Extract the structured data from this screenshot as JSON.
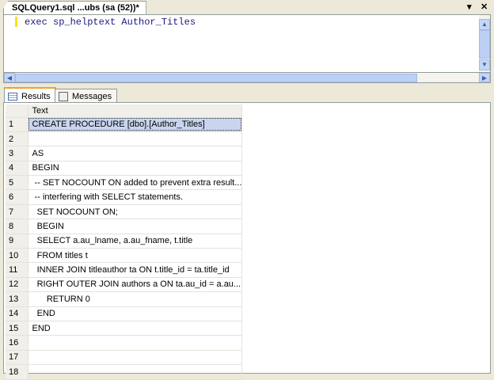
{
  "document_tab": {
    "title": "SQLQuery1.sql ...ubs (sa (52))*"
  },
  "window_controls": {
    "dropdown": "▾",
    "close": "✕"
  },
  "editor": {
    "code": "exec sp_helptext Author_Titles"
  },
  "result_tabs": [
    {
      "label": "Results",
      "icon": "grid-icon"
    },
    {
      "label": "Messages",
      "icon": "messages-icon"
    }
  ],
  "grid": {
    "column": "Text",
    "rows": [
      {
        "n": "1",
        "text": "CREATE PROCEDURE [dbo].[Author_Titles]"
      },
      {
        "n": "2",
        "text": ""
      },
      {
        "n": "3",
        "text": "AS"
      },
      {
        "n": "4",
        "text": "BEGIN"
      },
      {
        "n": "5",
        "text": " -- SET NOCOUNT ON added to prevent extra result..."
      },
      {
        "n": "6",
        "text": " -- interfering with SELECT statements."
      },
      {
        "n": "7",
        "text": "  SET NOCOUNT ON;"
      },
      {
        "n": "8",
        "text": "  BEGIN"
      },
      {
        "n": "9",
        "text": "  SELECT a.au_lname, a.au_fname, t.title"
      },
      {
        "n": "10",
        "text": "  FROM titles t"
      },
      {
        "n": "11",
        "text": "  INNER JOIN titleauthor ta ON t.title_id = ta.title_id"
      },
      {
        "n": "12",
        "text": "  RIGHT OUTER JOIN authors a ON ta.au_id = a.au..."
      },
      {
        "n": "13",
        "text": "      RETURN 0"
      },
      {
        "n": "14",
        "text": "  END"
      },
      {
        "n": "15",
        "text": "END"
      },
      {
        "n": "16",
        "text": ""
      },
      {
        "n": "17",
        "text": ""
      },
      {
        "n": "18",
        "text": ""
      }
    ]
  }
}
